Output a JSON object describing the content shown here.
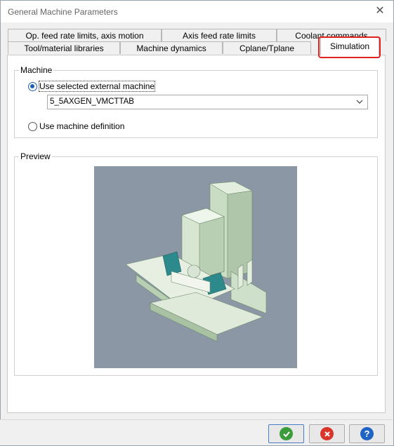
{
  "window": {
    "title": "General Machine Parameters"
  },
  "tabs": {
    "row_back": [
      {
        "label": "Op. feed rate limits, axis motion"
      },
      {
        "label": "Axis feed rate limits"
      },
      {
        "label": "Coolant commands"
      }
    ],
    "row_front": [
      {
        "label": "Tool/material libraries"
      },
      {
        "label": "Machine dynamics"
      },
      {
        "label": "Cplane/Tplane"
      },
      {
        "label": "Simulation",
        "active": true
      }
    ]
  },
  "machine_group": {
    "label": "Machine",
    "option_external": {
      "label": "Use selected external machine",
      "selected": true
    },
    "machine_select": {
      "value": "5_5AXGEN_VMCTTAB"
    },
    "option_definition": {
      "label": "Use machine definition",
      "selected": false
    }
  },
  "preview_group": {
    "label": "Preview"
  },
  "colors": {
    "accent": "#1b5fb8",
    "highlight": "#e0231e",
    "ok": "#3a9c3a",
    "cancel": "#d9352b",
    "help": "#1f63c4"
  },
  "buttons": {
    "ok": {
      "icon": "check-icon"
    },
    "cancel": {
      "icon": "x-icon"
    },
    "help": {
      "icon": "question-icon",
      "glyph": "?"
    }
  }
}
